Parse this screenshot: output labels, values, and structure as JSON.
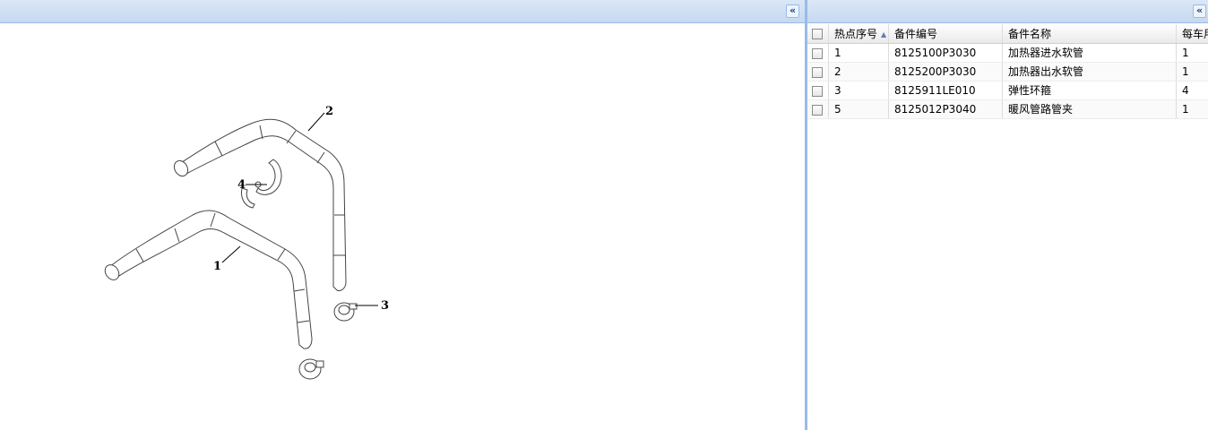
{
  "left_panel": {
    "collapse_icon": "double-chevron-left-icon",
    "collapse_glyph": "«"
  },
  "right_panel": {
    "collapse_icon": "double-chevron-left-icon",
    "collapse_glyph": "«"
  },
  "diagram": {
    "callouts": [
      "1",
      "2",
      "3",
      "4"
    ]
  },
  "grid": {
    "columns": [
      "热点序号",
      "备件编号",
      "备件名称",
      "每车用"
    ],
    "sort_indicator": "▲",
    "rows": [
      {
        "hotspot": "1",
        "code": "8125100P3030",
        "name": "加热器进水软管",
        "qty": "1"
      },
      {
        "hotspot": "2",
        "code": "8125200P3030",
        "name": "加热器出水软管",
        "qty": "1"
      },
      {
        "hotspot": "3",
        "code": "8125911LE010",
        "name": "弹性环箍",
        "qty": "4"
      },
      {
        "hotspot": "5",
        "code": "8125012P3040",
        "name": "暖风管路管夹",
        "qty": "1"
      }
    ]
  }
}
